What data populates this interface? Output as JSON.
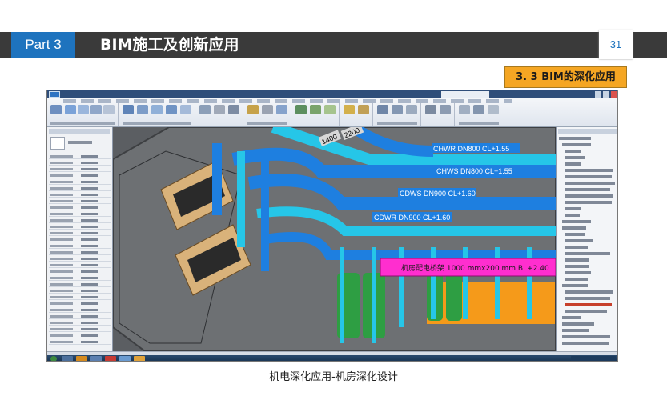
{
  "header": {
    "part_label": "Part 3",
    "title": "BIM施工及创新应用",
    "page_number": "31"
  },
  "section_tag": "3. 3  BIM的深化应用",
  "screenshot": {
    "pipes": [
      {
        "label": "CHWR DN800 CL+1.55"
      },
      {
        "label": "CHWS DN800 CL+1.55"
      },
      {
        "label": "CDWS DN900 CL+1.60"
      },
      {
        "label": "CDWR DN900 CL+1.60"
      }
    ],
    "cable_tray_label": "机房配电桥架 1000 mmx200 mm BL+2.40",
    "dimension_labels": [
      "1400",
      "2200"
    ]
  },
  "caption": "机电深化应用-机房深化设计",
  "colors": {
    "header_band": "#3a3a3a",
    "part_box": "#1e73be",
    "section_tag": "#f5a623",
    "pipe_blue": "#1e7fe0",
    "pipe_cyan": "#26c6e8",
    "cable_tray": "#ff2ecf",
    "equipment_orange": "#f59a1a",
    "equipment_green": "#2e9e43"
  }
}
